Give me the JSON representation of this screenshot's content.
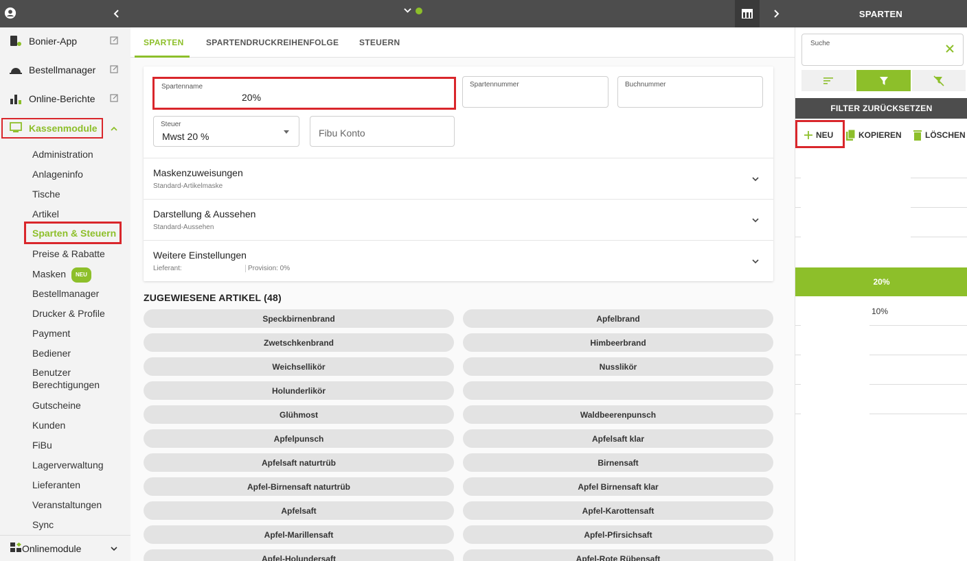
{
  "topbar": {
    "right_title": "SPARTEN"
  },
  "sidebar": {
    "links": [
      {
        "label": "Bonier-App"
      },
      {
        "label": "Bestellmanager"
      },
      {
        "label": "Online-Berichte"
      }
    ],
    "kassenmodule_label": "Kassenmodule",
    "sub_items": [
      "Administration",
      "Anlageninfo",
      "Tische",
      "Artikel",
      "Sparten & Steuern",
      "Preise & Rabatte",
      "Masken",
      "Bestellmanager",
      "Drucker & Profile",
      "Payment",
      "Bediener",
      "Benutzer Berechtigungen",
      "Gutscheine",
      "Kunden",
      "FiBu",
      "Lagerverwaltung",
      "Lieferanten",
      "Veranstaltungen",
      "Sync"
    ],
    "masken_badge": "NEU",
    "onlinemodule_label": "Onlinemodule"
  },
  "tabs": [
    "SPARTEN",
    "SPARTENDRUCKREIHENFOLGE",
    "STEUERN"
  ],
  "form": {
    "spartenname": {
      "label": "Spartenname",
      "value": "20%"
    },
    "spartennummer": {
      "label": "Spartennummer",
      "value": ""
    },
    "buchnummer": {
      "label": "Buchnummer",
      "value": ""
    },
    "steuer": {
      "label": "Steuer",
      "value": "Mwst 20 %"
    },
    "fibu": {
      "placeholder": "Fibu Konto"
    }
  },
  "accordions": [
    {
      "title": "Maskenzuweisungen",
      "subtitle": "Standard-Artikelmaske"
    },
    {
      "title": "Darstellung & Aussehen",
      "subtitle": "Standard-Aussehen"
    },
    {
      "title": "Weitere Einstellungen",
      "subtitle_left": "Lieferant:",
      "subtitle_right": "Provision: 0%"
    }
  ],
  "assigned": {
    "title": "ZUGEWIESENE ARTIKEL (48)",
    "items": [
      "Speckbirnenbrand",
      "Apfelbrand",
      "Zwetschkenbrand",
      "Himbeerbrand",
      "Weichsellikör",
      "Nusslikör",
      "Holunderlikör",
      "",
      "Glühmost",
      "Waldbeerenpunsch",
      "Apfelpunsch",
      "Apfelsaft klar",
      "Apfelsaft naturtrüb",
      "Birnensaft",
      "Apfel-Birnensaft naturtrüb",
      "Apfel Birnensaft klar",
      "Apfelsaft",
      "Apfel-Karottensaft",
      "Apfel-Marillensaft",
      "Apfel-Pfirsichsaft",
      "Apfel-Holundersaft",
      "Apfel-Rote Rübensaft"
    ]
  },
  "right_panel": {
    "search_label": "Suche",
    "filter_reset": "FILTER ZURÜCKSETZEN",
    "actions": {
      "new": "NEU",
      "copy": "KOPIEREN",
      "delete": "LÖSCHEN"
    },
    "selected": "20%",
    "other": "10%"
  },
  "colors": {
    "accent": "#8dbf2a",
    "highlight": "#d9262b",
    "dark": "#4d4d4d"
  }
}
